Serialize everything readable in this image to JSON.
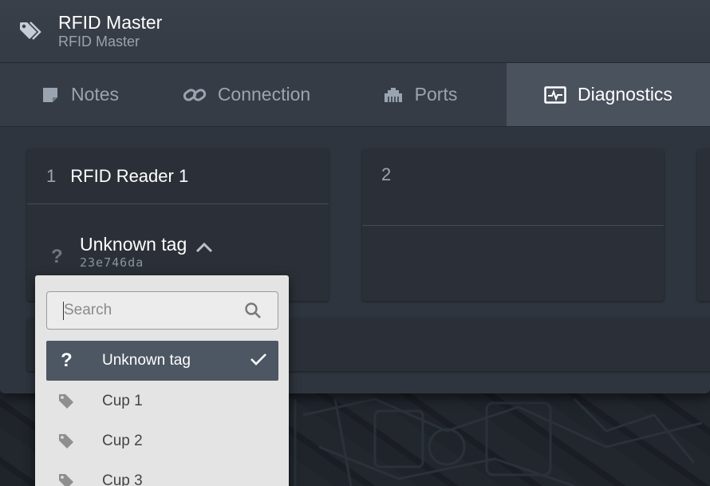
{
  "app": {
    "title": "RFID Master",
    "subtitle": "RFID Master"
  },
  "tabs": [
    {
      "label": "Notes",
      "icon": "note-icon"
    },
    {
      "label": "Connection",
      "icon": "link-icon"
    },
    {
      "label": "Ports",
      "icon": "ethernet-port-icon"
    },
    {
      "label": "Diagnostics",
      "icon": "monitor-pulse-icon",
      "active": true
    }
  ],
  "panels": [
    {
      "number": "1",
      "name": "RFID Reader 1",
      "tag": {
        "status_icon": "?",
        "name": "Unknown tag",
        "id": "23e746da"
      }
    },
    {
      "number": "2",
      "name": ""
    }
  ],
  "dropdown": {
    "search_placeholder": "Search",
    "options": [
      {
        "icon": "?",
        "label": "Unknown tag",
        "selected": true
      },
      {
        "icon": "tag-icon",
        "label": "Cup 1"
      },
      {
        "icon": "tag-icon",
        "label": "Cup 2"
      },
      {
        "icon": "tag-icon",
        "label": "Cup 3"
      }
    ]
  },
  "colors": {
    "accent_active_tab": "#4a525d",
    "selected_option": "#4d5663",
    "panel_bg": "#2b3038"
  }
}
